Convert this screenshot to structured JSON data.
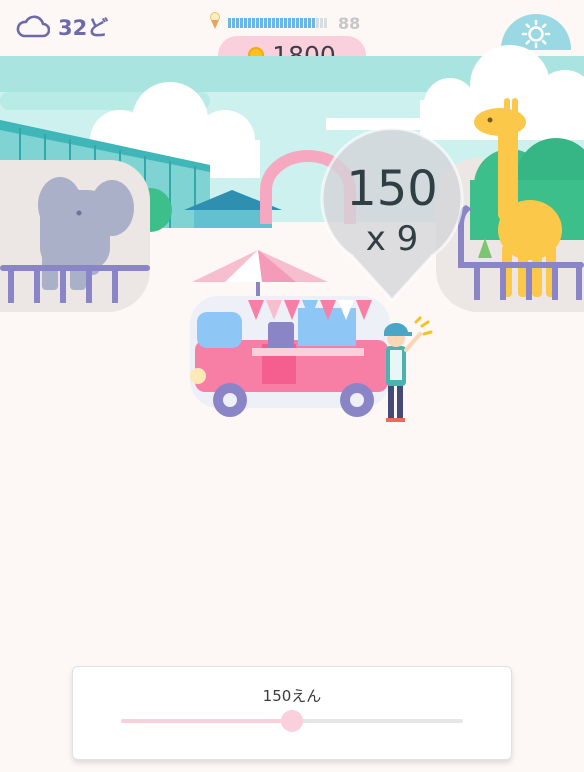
{
  "status": {
    "temperature": "32ど",
    "weather_icon": "cloud-icon",
    "energy_value": "88",
    "energy_fraction": 0.88,
    "coins": "1800"
  },
  "price_bubble": {
    "price": "150",
    "multiplier": "x 9"
  },
  "price_panel": {
    "label": "150えん",
    "slider_fraction": 0.5
  },
  "colors": {
    "accent_pink": "#fad0dc",
    "sky": "#9ad8e3",
    "truck_pink": "#f77fa6",
    "giraffe": "#fcc84a",
    "elephant": "#aab0c8",
    "fence": "#8a85c7"
  }
}
